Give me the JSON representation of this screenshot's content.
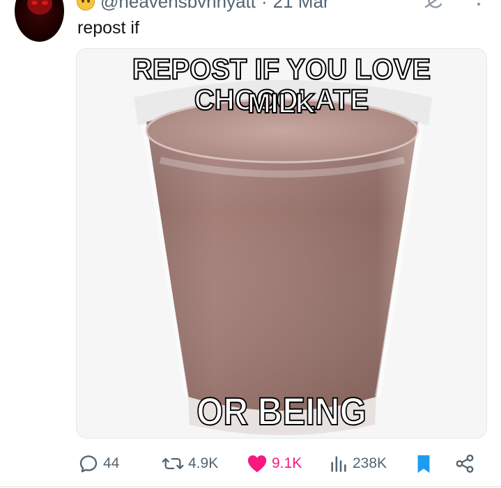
{
  "author": {
    "handle": "@heavensbvnnyatt",
    "date": "21 Mar",
    "separator": "·"
  },
  "tweet": {
    "text": "repost if"
  },
  "media": {
    "caption_top_line1": "REPOST IF YOU LOVE CHOCOLATE",
    "caption_top_line2": "MILK",
    "caption_bottom": "OR BEING DOMINATED"
  },
  "actions": {
    "replies": "44",
    "reposts": "4.9K",
    "likes": "9.1K",
    "views": "238K"
  },
  "colors": {
    "like": "#f91880",
    "bookmark": "#1d9bf0",
    "muted": "#536471"
  },
  "icons": [
    "grok-icon",
    "more-icon",
    "reply-icon",
    "repost-icon",
    "heart-icon",
    "views-icon",
    "bookmark-icon",
    "share-icon"
  ]
}
